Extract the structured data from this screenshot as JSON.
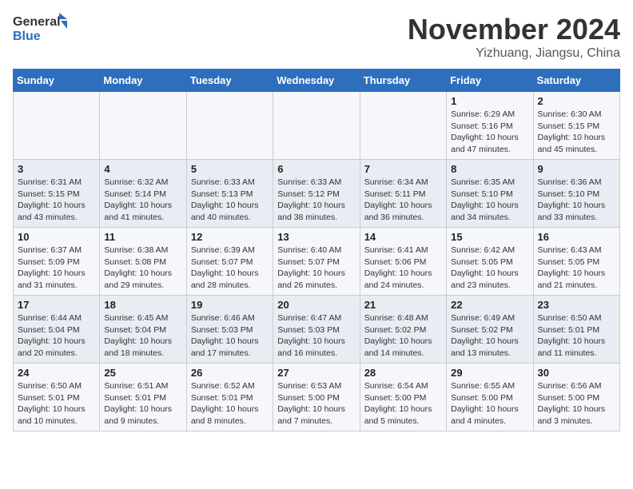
{
  "logo": {
    "general": "General",
    "blue": "Blue"
  },
  "title": "November 2024",
  "subtitle": "Yizhuang, Jiangsu, China",
  "weekdays": [
    "Sunday",
    "Monday",
    "Tuesday",
    "Wednesday",
    "Thursday",
    "Friday",
    "Saturday"
  ],
  "weeks": [
    [
      {
        "day": "",
        "info": ""
      },
      {
        "day": "",
        "info": ""
      },
      {
        "day": "",
        "info": ""
      },
      {
        "day": "",
        "info": ""
      },
      {
        "day": "",
        "info": ""
      },
      {
        "day": "1",
        "info": "Sunrise: 6:29 AM\nSunset: 5:16 PM\nDaylight: 10 hours and 47 minutes."
      },
      {
        "day": "2",
        "info": "Sunrise: 6:30 AM\nSunset: 5:15 PM\nDaylight: 10 hours and 45 minutes."
      }
    ],
    [
      {
        "day": "3",
        "info": "Sunrise: 6:31 AM\nSunset: 5:15 PM\nDaylight: 10 hours and 43 minutes."
      },
      {
        "day": "4",
        "info": "Sunrise: 6:32 AM\nSunset: 5:14 PM\nDaylight: 10 hours and 41 minutes."
      },
      {
        "day": "5",
        "info": "Sunrise: 6:33 AM\nSunset: 5:13 PM\nDaylight: 10 hours and 40 minutes."
      },
      {
        "day": "6",
        "info": "Sunrise: 6:33 AM\nSunset: 5:12 PM\nDaylight: 10 hours and 38 minutes."
      },
      {
        "day": "7",
        "info": "Sunrise: 6:34 AM\nSunset: 5:11 PM\nDaylight: 10 hours and 36 minutes."
      },
      {
        "day": "8",
        "info": "Sunrise: 6:35 AM\nSunset: 5:10 PM\nDaylight: 10 hours and 34 minutes."
      },
      {
        "day": "9",
        "info": "Sunrise: 6:36 AM\nSunset: 5:10 PM\nDaylight: 10 hours and 33 minutes."
      }
    ],
    [
      {
        "day": "10",
        "info": "Sunrise: 6:37 AM\nSunset: 5:09 PM\nDaylight: 10 hours and 31 minutes."
      },
      {
        "day": "11",
        "info": "Sunrise: 6:38 AM\nSunset: 5:08 PM\nDaylight: 10 hours and 29 minutes."
      },
      {
        "day": "12",
        "info": "Sunrise: 6:39 AM\nSunset: 5:07 PM\nDaylight: 10 hours and 28 minutes."
      },
      {
        "day": "13",
        "info": "Sunrise: 6:40 AM\nSunset: 5:07 PM\nDaylight: 10 hours and 26 minutes."
      },
      {
        "day": "14",
        "info": "Sunrise: 6:41 AM\nSunset: 5:06 PM\nDaylight: 10 hours and 24 minutes."
      },
      {
        "day": "15",
        "info": "Sunrise: 6:42 AM\nSunset: 5:05 PM\nDaylight: 10 hours and 23 minutes."
      },
      {
        "day": "16",
        "info": "Sunrise: 6:43 AM\nSunset: 5:05 PM\nDaylight: 10 hours and 21 minutes."
      }
    ],
    [
      {
        "day": "17",
        "info": "Sunrise: 6:44 AM\nSunset: 5:04 PM\nDaylight: 10 hours and 20 minutes."
      },
      {
        "day": "18",
        "info": "Sunrise: 6:45 AM\nSunset: 5:04 PM\nDaylight: 10 hours and 18 minutes."
      },
      {
        "day": "19",
        "info": "Sunrise: 6:46 AM\nSunset: 5:03 PM\nDaylight: 10 hours and 17 minutes."
      },
      {
        "day": "20",
        "info": "Sunrise: 6:47 AM\nSunset: 5:03 PM\nDaylight: 10 hours and 16 minutes."
      },
      {
        "day": "21",
        "info": "Sunrise: 6:48 AM\nSunset: 5:02 PM\nDaylight: 10 hours and 14 minutes."
      },
      {
        "day": "22",
        "info": "Sunrise: 6:49 AM\nSunset: 5:02 PM\nDaylight: 10 hours and 13 minutes."
      },
      {
        "day": "23",
        "info": "Sunrise: 6:50 AM\nSunset: 5:01 PM\nDaylight: 10 hours and 11 minutes."
      }
    ],
    [
      {
        "day": "24",
        "info": "Sunrise: 6:50 AM\nSunset: 5:01 PM\nDaylight: 10 hours and 10 minutes."
      },
      {
        "day": "25",
        "info": "Sunrise: 6:51 AM\nSunset: 5:01 PM\nDaylight: 10 hours and 9 minutes."
      },
      {
        "day": "26",
        "info": "Sunrise: 6:52 AM\nSunset: 5:01 PM\nDaylight: 10 hours and 8 minutes."
      },
      {
        "day": "27",
        "info": "Sunrise: 6:53 AM\nSunset: 5:00 PM\nDaylight: 10 hours and 7 minutes."
      },
      {
        "day": "28",
        "info": "Sunrise: 6:54 AM\nSunset: 5:00 PM\nDaylight: 10 hours and 5 minutes."
      },
      {
        "day": "29",
        "info": "Sunrise: 6:55 AM\nSunset: 5:00 PM\nDaylight: 10 hours and 4 minutes."
      },
      {
        "day": "30",
        "info": "Sunrise: 6:56 AM\nSunset: 5:00 PM\nDaylight: 10 hours and 3 minutes."
      }
    ]
  ]
}
